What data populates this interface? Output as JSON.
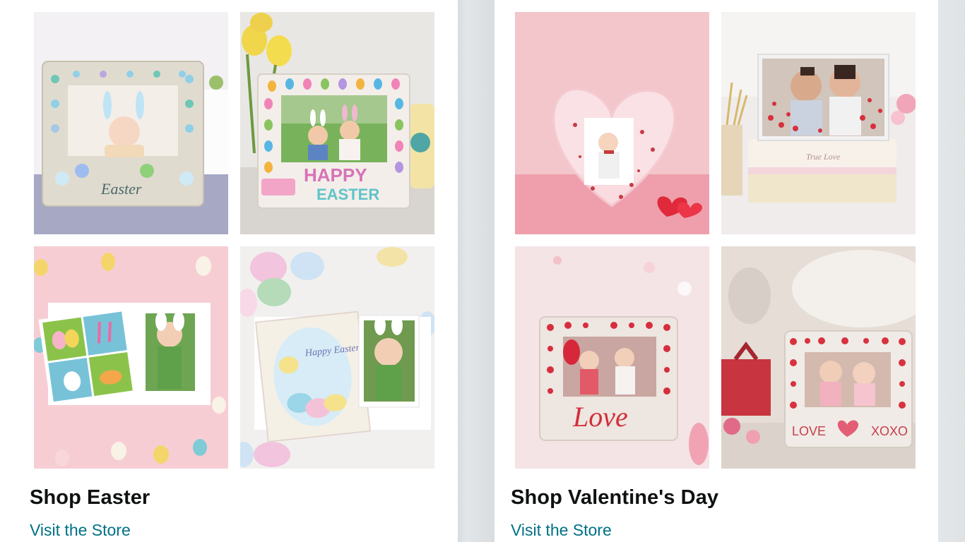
{
  "cards": [
    {
      "title": "Shop Easter",
      "link_label": "Visit the Store",
      "images": [
        {
          "name": "easter-wooden-frame-baby-bunny"
        },
        {
          "name": "easter-happy-easter-frame-kids"
        },
        {
          "name": "easter-card-frame-girl-bunny-ears"
        },
        {
          "name": "easter-chick-eggs-card-girl"
        }
      ],
      "image_texts": {
        "frame1_text": "Easter",
        "frame2_line1": "HAPPY",
        "frame2_line2": "EASTER",
        "card2_text": "Happy Easter"
      }
    },
    {
      "title": "Shop Valentine's Day",
      "link_label": "Visit the Store",
      "images": [
        {
          "name": "valentine-heart-snow-globe-frame"
        },
        {
          "name": "valentine-couple-glitter-frame"
        },
        {
          "name": "valentine-love-wooden-frame"
        },
        {
          "name": "valentine-love-xoxo-frame"
        }
      ],
      "image_texts": {
        "frame3_text": "Love",
        "frame4_left": "LOVE",
        "frame4_right": "XOXO",
        "book_text": "True Love"
      }
    }
  ],
  "colors": {
    "title": "#0f1111",
    "link": "#007185",
    "page_bg": "#e6e9eb"
  }
}
